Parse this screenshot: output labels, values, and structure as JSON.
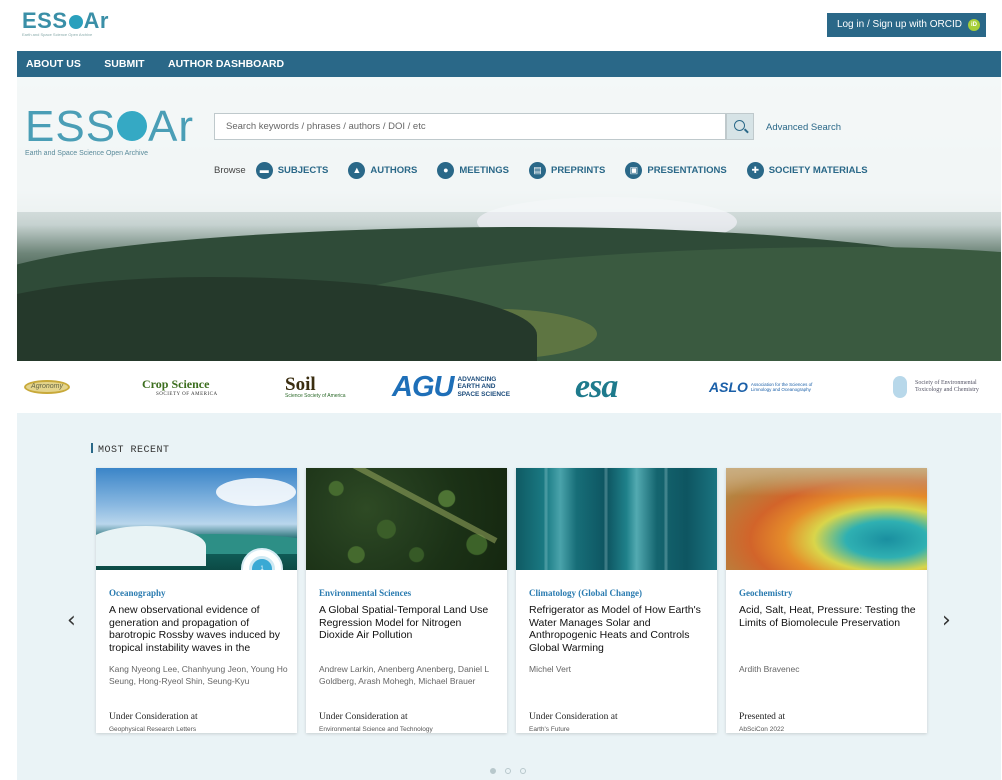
{
  "top": {
    "logo_word": "ESSOAr",
    "logo_sub": "Earth and Space Science Open Archive",
    "login_label": "Log in / Sign up with ORCID",
    "orcid_icon": "iD"
  },
  "nav": {
    "items": [
      "ABOUT US",
      "SUBMIT",
      "AUTHOR DASHBOARD"
    ]
  },
  "hero": {
    "logo_word": "ESSOAr",
    "logo_sub": "Earth and Space Science Open Archive",
    "search_placeholder": "Search keywords / phrases / authors / DOI / etc",
    "advanced_search": "Advanced Search",
    "browse_label": "Browse",
    "browse_items": [
      {
        "label": "SUBJECTS",
        "icon": "book-icon"
      },
      {
        "label": "AUTHORS",
        "icon": "graduation-cap-icon"
      },
      {
        "label": "MEETINGS",
        "icon": "meeting-icon"
      },
      {
        "label": "PREPRINTS",
        "icon": "document-icon"
      },
      {
        "label": "PRESENTATIONS",
        "icon": "presentation-icon"
      },
      {
        "label": "SOCIETY MATERIALS",
        "icon": "society-icon"
      }
    ]
  },
  "partners": {
    "agronomy": "Agronomy",
    "crop_title": "Crop Science",
    "crop_sub": "SOCIETY OF AMERICA",
    "soil_title": "Soil",
    "soil_sub": "Science Society of America",
    "agu_big": "AGU",
    "agu_small_1": "ADVANCING",
    "agu_small_2": "EARTH AND",
    "agu_small_3": "SPACE SCIENCE",
    "esa": "esa",
    "aslo_big": "ASLO",
    "aslo_small_1": "Association for the Sciences of",
    "aslo_small_2": "Limnology and Oceanography",
    "setac_1": "Society of Environmental",
    "setac_2": "Toxicology and Chemistry"
  },
  "recent": {
    "title": "MOST RECENT",
    "prev_arrow": "‹",
    "next_arrow": "›",
    "cards": [
      {
        "subject": "Oceanography",
        "title": "A new observational evidence of generation and propagation of barotropic Rossby waves induced by tropical instability waves in the",
        "authors": "Kang Nyeong Lee, Chanhyung Jeon, Young Ho Seung, Hong-Ryeol Shin, Seung-Kyu",
        "status": "Under Consideration at",
        "venue": "Geophysical Research Letters",
        "badge": "1"
      },
      {
        "subject": "Environmental Sciences",
        "title": "A Global Spatial-Temporal Land Use Regression Model for Nitrogen Dioxide Air Pollution",
        "authors": "Andrew Larkin, Anenberg Anenberg, Daniel L Goldberg, Arash Mohegh, Michael Brauer",
        "status": "Under Consideration at",
        "venue": "Environmental Science and Technology"
      },
      {
        "subject": "Climatology (Global Change)",
        "title": "Refrigerator as Model of How Earth's Water Manages Solar and Anthropogenic Heats and Controls Global Warming",
        "authors": "Michel Vert",
        "status": "Under Consideration at",
        "venue": "Earth's Future"
      },
      {
        "subject": "Geochemistry",
        "title": "Acid, Salt, Heat, Pressure: Testing the Limits of Biomolecule Preservation",
        "authors": "Ardith Bravenec",
        "status": "Presented at",
        "venue": "AbSciCon 2022"
      }
    ],
    "pagination_count": 3,
    "pagination_active": 1
  },
  "colors": {
    "brand": "#2a6888",
    "accent": "#35a9c4",
    "subject": "#2a7bb0",
    "section_bg": "#eaf3f6"
  }
}
